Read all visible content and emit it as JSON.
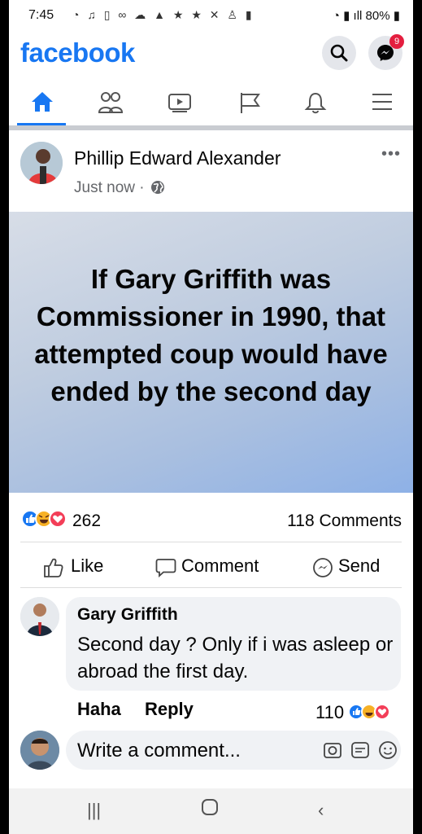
{
  "status_bar": {
    "time": "7:45",
    "battery": "80%",
    "icon_names": [
      "wifi-icon",
      "music-icon",
      "sim-icon",
      "voicemail-icon",
      "cloud-icon",
      "notification-icon",
      "star-icon",
      "star-icon",
      "missed-call-icon",
      "person-icon",
      "battery-saver-icon"
    ]
  },
  "header": {
    "logo": "facebook",
    "messenger_badge": "9"
  },
  "tabs": [
    {
      "name": "home",
      "active": true
    },
    {
      "name": "friends",
      "active": false
    },
    {
      "name": "watch",
      "active": false
    },
    {
      "name": "pages",
      "active": false
    },
    {
      "name": "notifications",
      "active": false
    },
    {
      "name": "menu",
      "active": false
    }
  ],
  "post": {
    "author": "Phillip Edward Alexander",
    "time": "Just now ·",
    "banner_text": "If Gary Griffith was Commissioner in 1990, that attempted coup would have ended by the second day",
    "reaction_count": "262",
    "comments_count": "118 Comments",
    "actions": {
      "like": "Like",
      "comment": "Comment",
      "send": "Send"
    }
  },
  "comment": {
    "author": "Gary Griffith",
    "text": "Second day ? Only if i was asleep or abroad the first day.",
    "haha": "Haha",
    "reply": "Reply",
    "reaction_count": "110"
  },
  "composer": {
    "placeholder": "Write a comment..."
  },
  "colors": {
    "brand": "#1877f2",
    "like": "#1877f2",
    "love": "#f33e58",
    "haha": "#f7b125"
  }
}
